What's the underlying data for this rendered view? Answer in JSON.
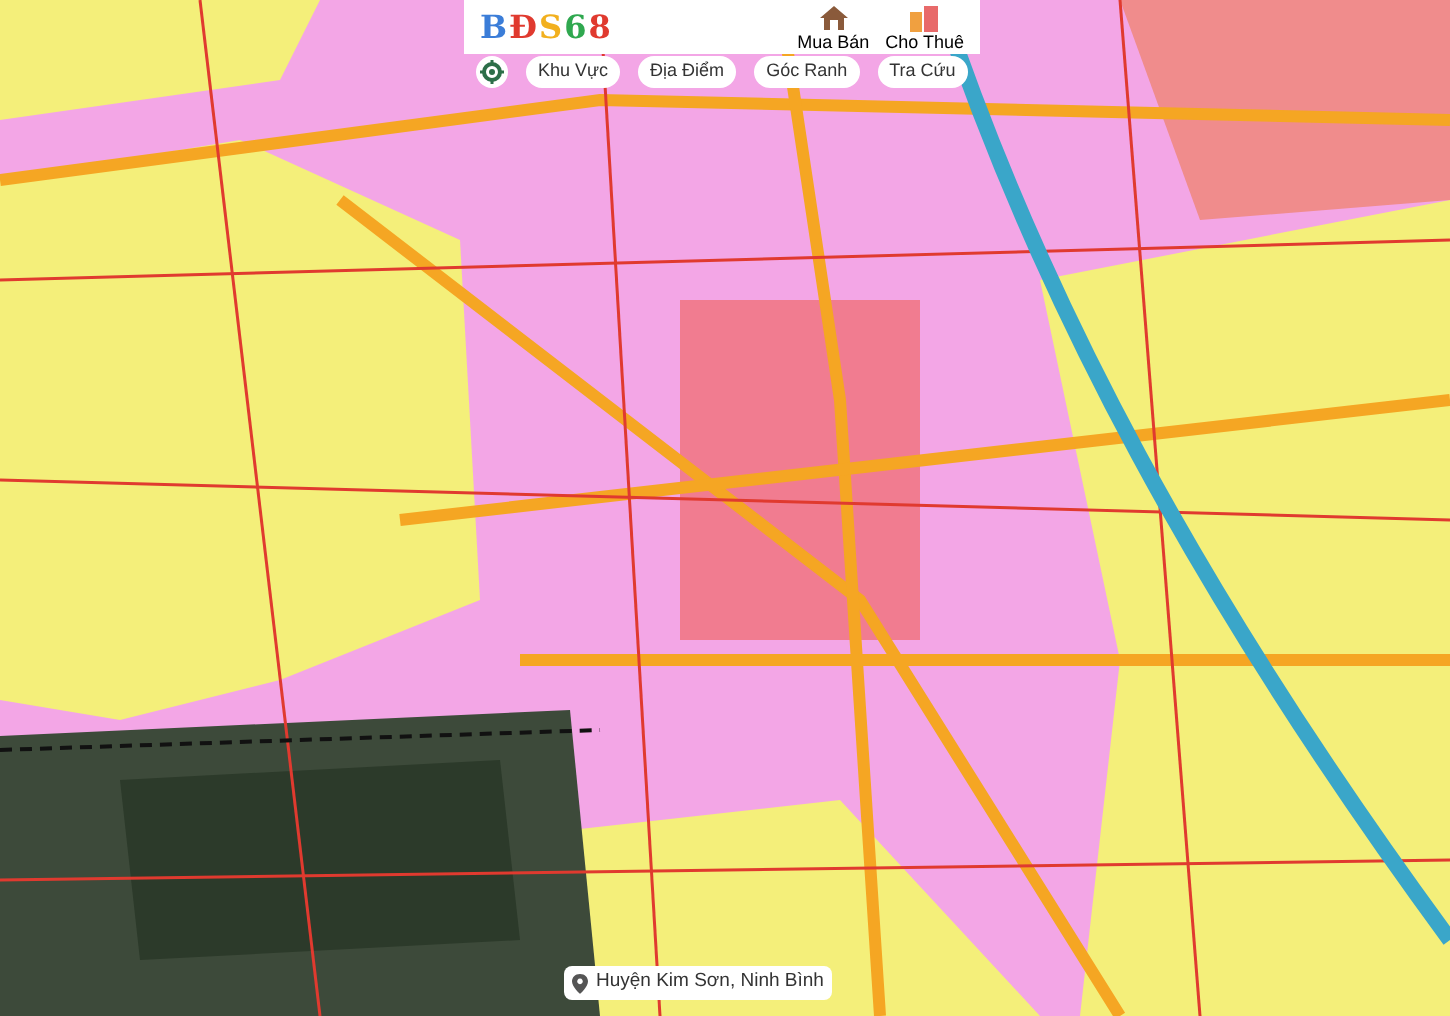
{
  "logo": {
    "letters": [
      {
        "char": "B",
        "color": "#3b7dd8"
      },
      {
        "char": "Đ",
        "color": "#e03a2f"
      },
      {
        "char": "S",
        "color": "#f2b01e"
      },
      {
        "char": "6",
        "color": "#2fa84f"
      },
      {
        "char": "8",
        "color": "#e03a2f"
      }
    ]
  },
  "menu": [
    {
      "label": "Mua Bán",
      "kind": "house"
    },
    {
      "label": "Cho Thuê",
      "kind": "building"
    }
  ],
  "tools": [
    {
      "label": "Khu Vực"
    },
    {
      "label": "Địa Điểm"
    },
    {
      "label": "Góc Ranh"
    },
    {
      "label": "Tra Cứu"
    }
  ],
  "location": {
    "label": "Huyện Kim Sơn, Ninh Bình"
  }
}
